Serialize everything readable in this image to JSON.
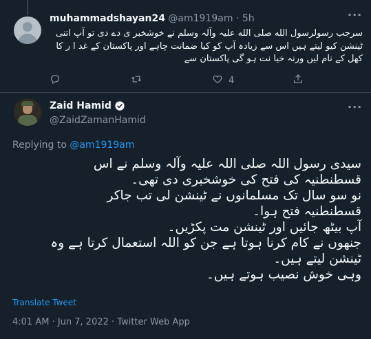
{
  "reply": {
    "name": "muhammadshayan24",
    "handle": "@am1919am",
    "separator": "·",
    "time": "5h",
    "text": "سرجب  رسولرسول الله صلی الله علیہ وآلہ وسلم نے خوشخبر ی  دے دی تو آپ اتنی ٹینشن کیو لیتے ہیں   اس سے زیادہ  آپ کو کیا ضمانت چاہے اور پاکستان کے غد ا ر  کا کھل کے  نام  لیں ورنہ خیا نت ہو گی پاکستان  سے",
    "actions": {
      "reply_count": "",
      "retweet_count": "",
      "like_count": "4"
    }
  },
  "tweet": {
    "name": "Zaid Hamid",
    "handle": "@ZaidZamanHamid",
    "replying_prefix": "Replying to",
    "replying_mention": "@am1919am",
    "lines": [
      "سیدی رسول اللہ صلی اللہ علیہ وآلہ وسلم نے اس",
      "قسطنطنیہ کی فتح کی خوشخبری دی تھی۔",
      "نو سو سال تک مسلمانوں نے ٹینشن لی تب جاکر",
      "قسطنطنیہ فتح ہوا۔",
      "آپ بیٹھ جائیں اور ٹینشن مت پکڑیں۔",
      "جنھوں نے کام کرنا ہوتا ہے جن کو اللہ استعمال کرتا ہے وہ",
      "ٹینشن لیتے ہیں۔",
      "وہی خوش نصیب ہوتے ہیں۔"
    ],
    "translate_label": "Translate Tweet",
    "meta": "4:01 AM · Jun 7, 2022 · Twitter Web App"
  },
  "icons": {
    "more": "more-dots-icon",
    "reply": "reply-icon",
    "retweet": "retweet-icon",
    "like": "heart-icon",
    "share": "share-icon",
    "verified": "verified-badge-icon"
  },
  "colors": {
    "background": "#15202b",
    "text": "#f7f9f9",
    "muted": "#8b98a5",
    "accent": "#1d9bf0",
    "border": "#38444d"
  }
}
